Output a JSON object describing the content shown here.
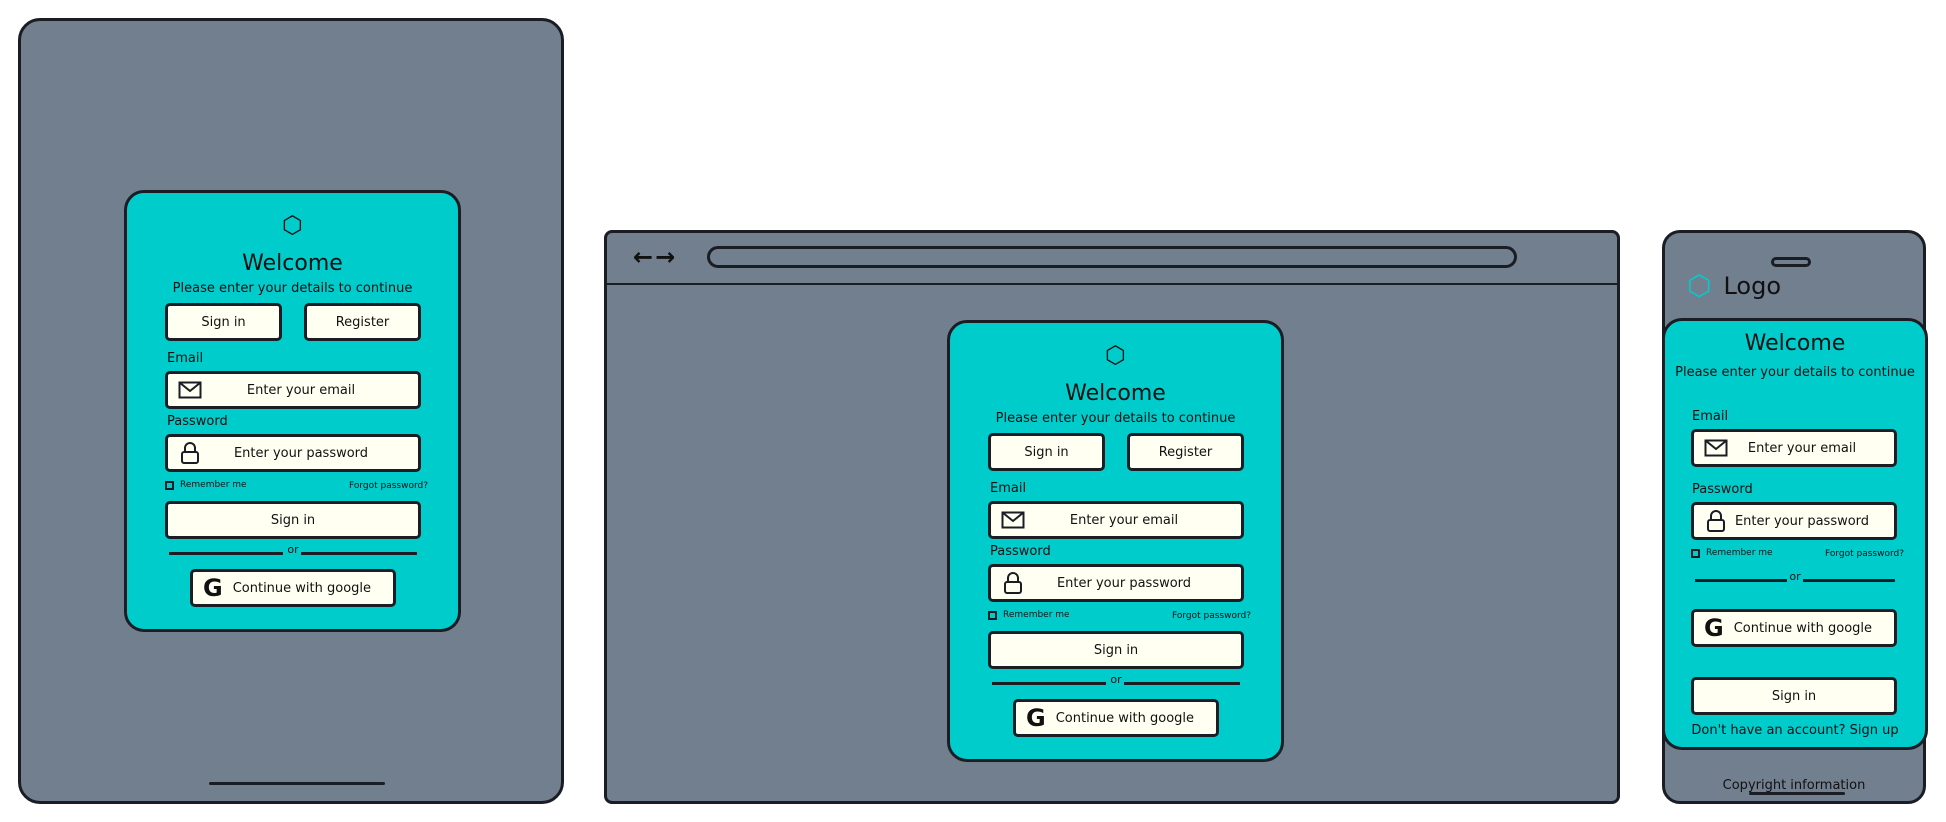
{
  "login": {
    "logo_glyph": "⬡",
    "title": "Welcome",
    "subtitle": "Please enter your details to continue",
    "tab_signin": "Sign in",
    "tab_register": "Register",
    "email_label": "Email",
    "email_placeholder": "Enter your email",
    "password_label": "Password",
    "password_placeholder": "Enter your password",
    "remember_me": "Remember me",
    "forgot_password": "Forgot password?",
    "signin_button": "Sign in",
    "or_divider": "or",
    "google_button": "Continue with google"
  },
  "browser": {
    "nav_arrows": "←→"
  },
  "phone": {
    "logo_text": "Logo",
    "signup_prompt": "Don't have an account? Sign up",
    "copyright": "Copyright information"
  },
  "colors": {
    "card": "#00cccc",
    "device": "#717f8f",
    "button": "#fffff2",
    "outline": "#1a1d24"
  },
  "icons": {
    "logo": "hexagon-icon",
    "email": "envelope-icon",
    "password": "lock-icon",
    "google": "google-icon",
    "checkbox": "checkbox-icon"
  }
}
